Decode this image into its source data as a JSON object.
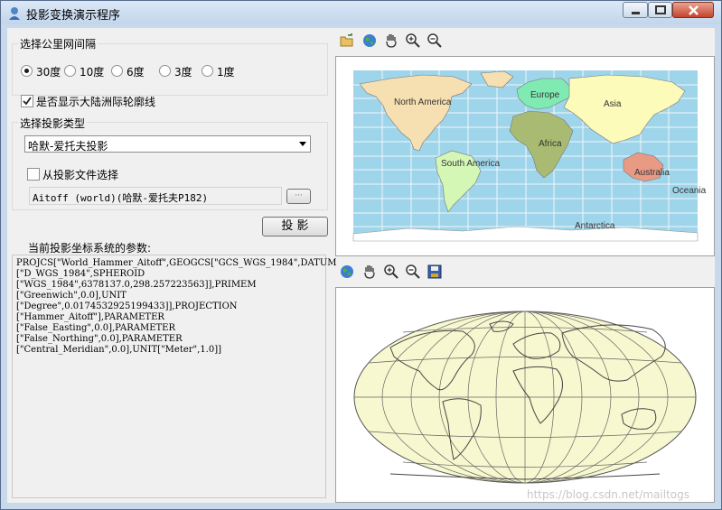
{
  "window": {
    "title": "投影变换演示程序"
  },
  "grid_interval": {
    "label": "选择公里网间隔",
    "options": [
      "30度",
      "10度",
      "6度",
      "3度",
      "1度"
    ],
    "selected": "30度"
  },
  "show_outline": {
    "label": "是否显示大陆洲际轮廓线",
    "checked": true
  },
  "projection_type": {
    "label": "选择投影类型",
    "selected": "哈默-爱托夫投影"
  },
  "from_file": {
    "label": "从投影文件选择",
    "checked": false,
    "path_value": "Aitoff (world)(哈默-爱托夫P182)",
    "browse_label": "···"
  },
  "project_button": "投 影",
  "params": {
    "label": "当前投影坐标系统的参数:",
    "lines": [
      "PROJCS[\"World_Hammer_Aitoff\",GEOGCS[\"GCS_WGS_1984\",DATUM",
      "[\"D_WGS_1984\",SPHEROID",
      "[\"WGS_1984\",6378137.0,298.257223563]],PRIMEM",
      "[\"Greenwich\",0.0],UNIT",
      "[\"Degree\",0.0174532925199433]],PROJECTION",
      "[\"Hammer_Aitoff\"],PARAMETER",
      "[\"False_Easting\",0.0],PARAMETER",
      "[\"False_Northing\",0.0],PARAMETER",
      "[\"Central_Meridian\",0.0],UNIT[\"Meter\",1.0]]"
    ]
  },
  "top_toolbar": [
    "open-file-icon",
    "globe-icon",
    "pan-hand-icon",
    "zoom-in-icon",
    "zoom-out-icon"
  ],
  "bottom_toolbar": [
    "globe-icon",
    "pan-hand-icon",
    "zoom-in-icon",
    "zoom-out-icon",
    "save-icon"
  ],
  "source_map": {
    "labels": {
      "north_america": "North America",
      "europe": "Europe",
      "asia": "Asia",
      "africa": "Africa",
      "south_america": "South America",
      "australia": "Australia",
      "oceania": "Oceania",
      "antarctica": "Antarctica"
    },
    "colors": {
      "ocean": "#9fd5ea",
      "north_america": "#f6dfb0",
      "europe": "#80eab3",
      "asia": "#fdfbba",
      "africa": "#a9bb73",
      "south_america": "#d4f7b6",
      "australia": "#e89a85",
      "antarctica": "#ffffff"
    }
  },
  "projected_map": {
    "fill": "#f7f8cf"
  },
  "watermark": "https://blog.csdn.net/mailtogs"
}
